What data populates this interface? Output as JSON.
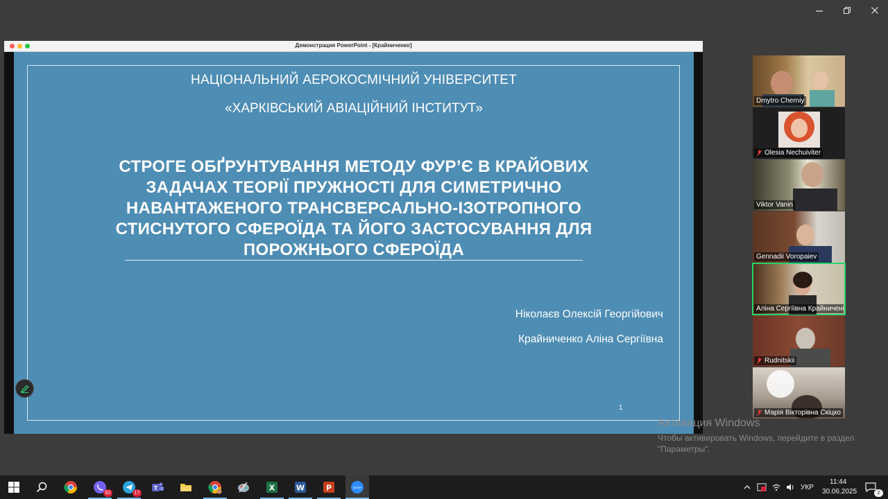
{
  "window": {
    "share_title": "Демонстрация PowerPoint - [Крайниченко]"
  },
  "slide": {
    "university_line1": "НАЦІОНАЛЬНИЙ АЕРОКОСМІЧНИЙ УНІВЕРСИТЕТ",
    "university_line2": "«ХАРКІВСЬКИЙ АВІАЦІЙНИЙ ІНСТИТУТ»",
    "title_lines": [
      "СТРОГЕ ОБҐРУНТУВАННЯ МЕТОДУ ФУР’Є В КРАЙОВИХ",
      "ЗАДАЧАХ ТЕОРІЇ ПРУЖНОСТІ ДЛЯ СИМЕТРИЧНО",
      "НАВАНТАЖЕНОГО ТРАНСВЕРСАЛЬНО-ІЗОТРОПНОГО",
      "СТИСНУТОГО СФЕРОЇДА ТА ЙОГО ЗАСТОСУВАННЯ ДЛЯ",
      "ПОРОЖНЬОГО СФЕРОЇДА"
    ],
    "author1": "Ніколаєв Олексій Георгійович",
    "author2": "Крайниченко Аліна Сергіївна",
    "page_number": "1"
  },
  "participants": [
    {
      "name": "Dmytro Cherniy",
      "muted": false
    },
    {
      "name": "Olesia Nechuiviter",
      "muted": true
    },
    {
      "name": "Viktor  Vanin",
      "muted": false
    },
    {
      "name": "Gennadii Voropaiev",
      "muted": false
    },
    {
      "name": "Аліна Сергіївна Крайниченко",
      "muted": false,
      "active": true
    },
    {
      "name": "Rudnitskii",
      "muted": true
    },
    {
      "name": "Марія Вікторівна Скіцко",
      "muted": true
    }
  ],
  "watermark": {
    "title": "Активация Windows",
    "body": "Чтобы активировать Windows, перейдите в раздел \"Параметры\"."
  },
  "taskbar": {
    "viber_badge": "62",
    "telegram_badge": "17",
    "language": "УКР",
    "time": "11:44",
    "date": "30.06.2025",
    "notifications": "2"
  },
  "colors": {
    "slide_bg": "#4e8db4",
    "active_speaker": "#27d36b",
    "taskbar": "#1c1c1c"
  }
}
